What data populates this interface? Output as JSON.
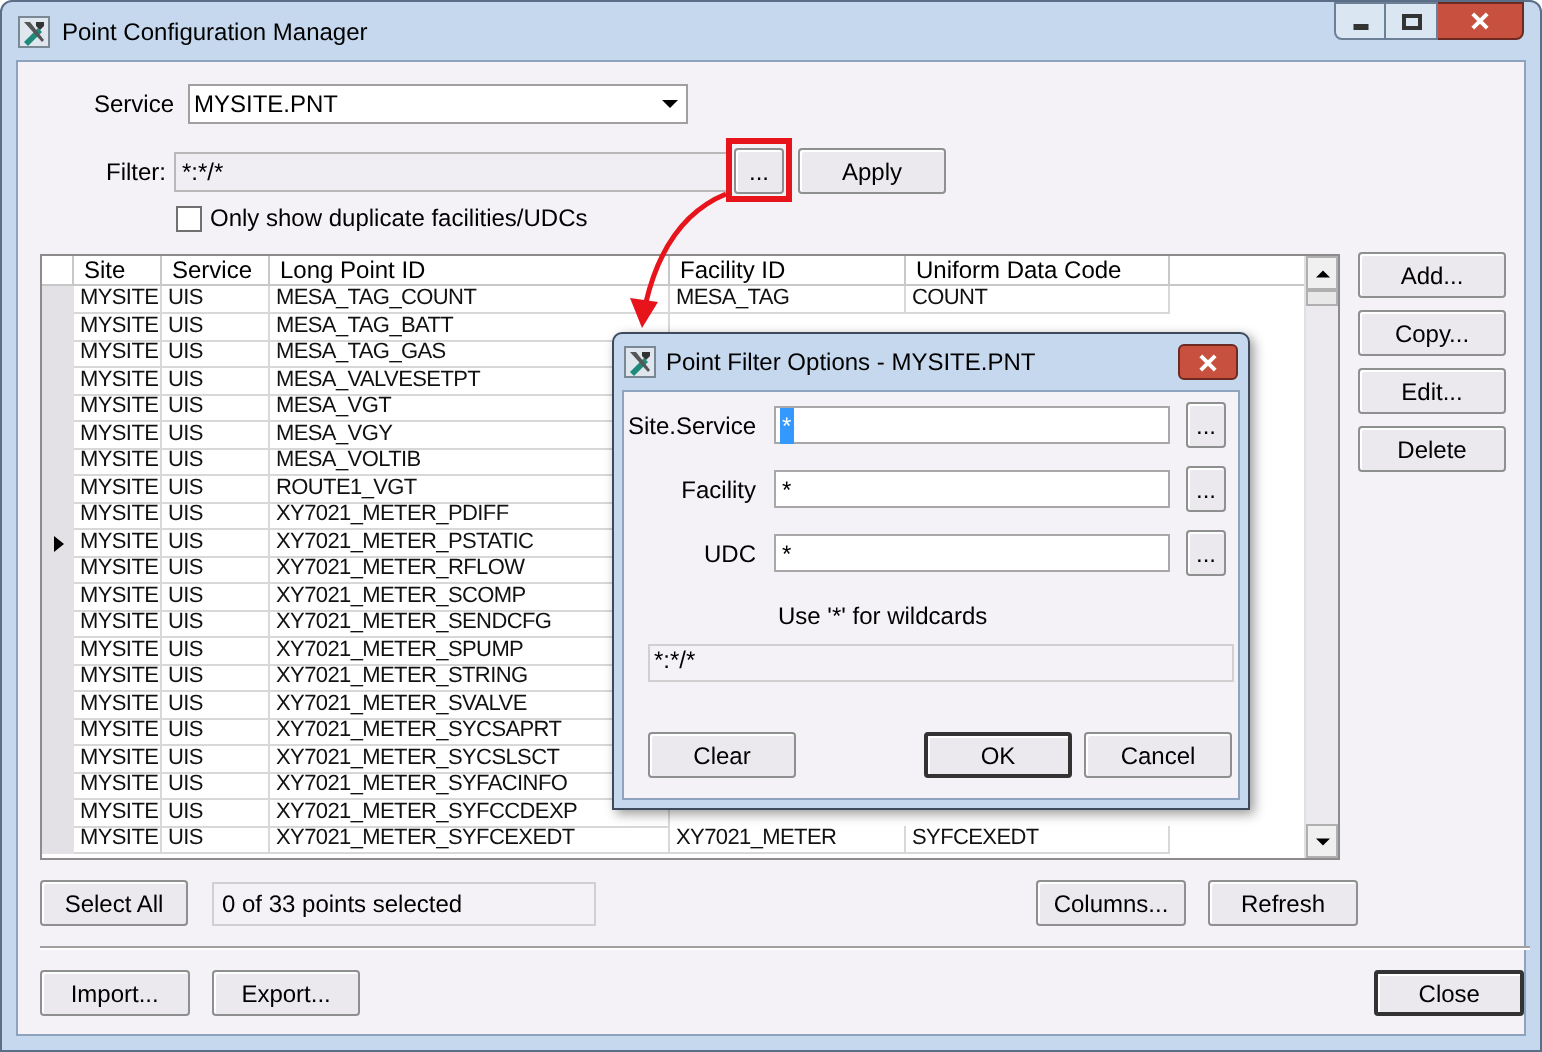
{
  "window": {
    "title": "Point Configuration Manager"
  },
  "service": {
    "label": "Service",
    "value": "MYSITE.PNT"
  },
  "filter": {
    "label": "Filter:",
    "value": "*:*/*",
    "browse_button": "...",
    "apply_button": "Apply",
    "highlighted": true
  },
  "duplicates_checkbox": {
    "label": "Only show duplicate facilities/UDCs",
    "checked": false
  },
  "table": {
    "columns": [
      "Site",
      "Service",
      "Long Point ID",
      "Facility ID",
      "Uniform Data Code"
    ],
    "rows": [
      {
        "site": "MYSITE",
        "service": "UIS",
        "long_point_id": "MESA_TAG_COUNT",
        "facility_id": "MESA_TAG",
        "udc": "COUNT",
        "current": false
      },
      {
        "site": "MYSITE",
        "service": "UIS",
        "long_point_id": "MESA_TAG_BATT",
        "current": false
      },
      {
        "site": "MYSITE",
        "service": "UIS",
        "long_point_id": "MESA_TAG_GAS",
        "current": false
      },
      {
        "site": "MYSITE",
        "service": "UIS",
        "long_point_id": "MESA_VALVESETPT",
        "current": false
      },
      {
        "site": "MYSITE",
        "service": "UIS",
        "long_point_id": "MESA_VGT",
        "current": false
      },
      {
        "site": "MYSITE",
        "service": "UIS",
        "long_point_id": "MESA_VGY",
        "current": false
      },
      {
        "site": "MYSITE",
        "service": "UIS",
        "long_point_id": "MESA_VOLTIB",
        "current": false
      },
      {
        "site": "MYSITE",
        "service": "UIS",
        "long_point_id": "ROUTE1_VGT",
        "current": false
      },
      {
        "site": "MYSITE",
        "service": "UIS",
        "long_point_id": "XY7021_METER_PDIFF",
        "current": false
      },
      {
        "site": "MYSITE",
        "service": "UIS",
        "long_point_id": "XY7021_METER_PSTATIC",
        "current": true
      },
      {
        "site": "MYSITE",
        "service": "UIS",
        "long_point_id": "XY7021_METER_RFLOW",
        "current": false
      },
      {
        "site": "MYSITE",
        "service": "UIS",
        "long_point_id": "XY7021_METER_SCOMP",
        "current": false
      },
      {
        "site": "MYSITE",
        "service": "UIS",
        "long_point_id": "XY7021_METER_SENDCFG",
        "current": false
      },
      {
        "site": "MYSITE",
        "service": "UIS",
        "long_point_id": "XY7021_METER_SPUMP",
        "current": false
      },
      {
        "site": "MYSITE",
        "service": "UIS",
        "long_point_id": "XY7021_METER_STRING",
        "current": false
      },
      {
        "site": "MYSITE",
        "service": "UIS",
        "long_point_id": "XY7021_METER_SVALVE",
        "current": false
      },
      {
        "site": "MYSITE",
        "service": "UIS",
        "long_point_id": "XY7021_METER_SYCSAPRT",
        "current": false
      },
      {
        "site": "MYSITE",
        "service": "UIS",
        "long_point_id": "XY7021_METER_SYCSLSCT",
        "current": false
      },
      {
        "site": "MYSITE",
        "service": "UIS",
        "long_point_id": "XY7021_METER_SYFACINFO",
        "current": false
      },
      {
        "site": "MYSITE",
        "service": "UIS",
        "long_point_id": "XY7021_METER_SYFCCDEXP",
        "current": false
      },
      {
        "site": "MYSITE",
        "service": "UIS",
        "long_point_id": "XY7021_METER_SYFCEXEDT",
        "facility_id": "XY7021_METER",
        "udc": "SYFCEXEDT",
        "current": false
      }
    ]
  },
  "side_buttons": [
    "Add...",
    "Copy...",
    "Edit...",
    "Delete"
  ],
  "select_all_button": "Select All",
  "status": "0 of 33 points selected",
  "columns_button": "Columns...",
  "refresh_button": "Refresh",
  "import_button": "Import...",
  "export_button": "Export...",
  "close_button": "Close",
  "dialog": {
    "title": "Point Filter Options - MYSITE.PNT",
    "fields": [
      {
        "label": "Site.Service",
        "value": "*",
        "text_selected": true,
        "browse_button": "..."
      },
      {
        "label": "Facility",
        "value": "*",
        "text_selected": false,
        "browse_button": "..."
      },
      {
        "label": "UDC",
        "value": "*",
        "text_selected": false,
        "browse_button": "..."
      }
    ],
    "hint": "Use '*' for wildcards",
    "preview": "*:*/*",
    "clear_button": "Clear",
    "ok_button": "OK",
    "cancel_button": "Cancel"
  }
}
